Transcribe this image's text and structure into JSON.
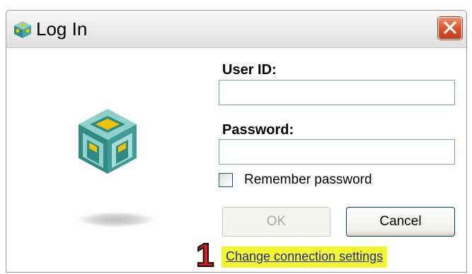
{
  "window": {
    "title": "Log In",
    "app_icon": "cube-app-icon",
    "close_icon": "close-icon"
  },
  "form": {
    "user_id_label": "User ID:",
    "user_id_value": "",
    "password_label": "Password:",
    "password_value": "",
    "remember_label": "Remember password",
    "remember_checked": false
  },
  "buttons": {
    "ok_label": "OK",
    "ok_enabled": false,
    "cancel_label": "Cancel"
  },
  "link": {
    "change_settings_label": "Change connection settings"
  },
  "annotation": {
    "marker": "1"
  },
  "colors": {
    "logo_teal": "#2f8a86",
    "logo_light": "#8fd0cb",
    "logo_yellow": "#f2c400",
    "close_red": "#d8502a",
    "highlight": "#f5f52e",
    "annotation_red": "#e51b1b"
  }
}
